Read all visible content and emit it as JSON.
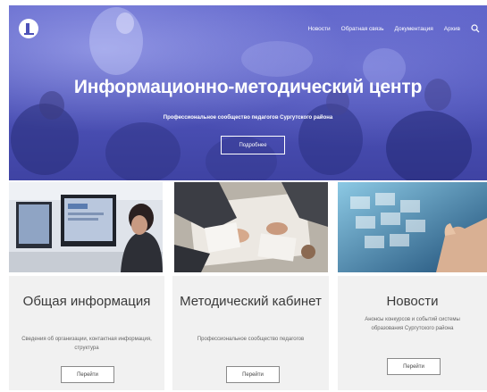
{
  "header": {
    "nav": [
      "Новости",
      "Обратная связь",
      "Документация",
      "Архив"
    ],
    "search_icon": "search-icon",
    "logo_icon": "logo-icon"
  },
  "hero": {
    "title": "Информационно-методический центр",
    "subtitle": "Профессиональное сообщество педагогов Сургутского района",
    "button": "Подробнее",
    "overlay_color": "#5257bf"
  },
  "cards": [
    {
      "title": "Общая информация",
      "text": "Сведения об организации, контактная информация, структура",
      "button": "Перейти"
    },
    {
      "title": "Методический кабинет",
      "text": "Профессиональное сообщество педагогов",
      "button": "Перейти"
    },
    {
      "title": "Новости",
      "text": "Анонсы конкурсов и событий системы образования Сургутского района",
      "button": "Перейти"
    }
  ]
}
